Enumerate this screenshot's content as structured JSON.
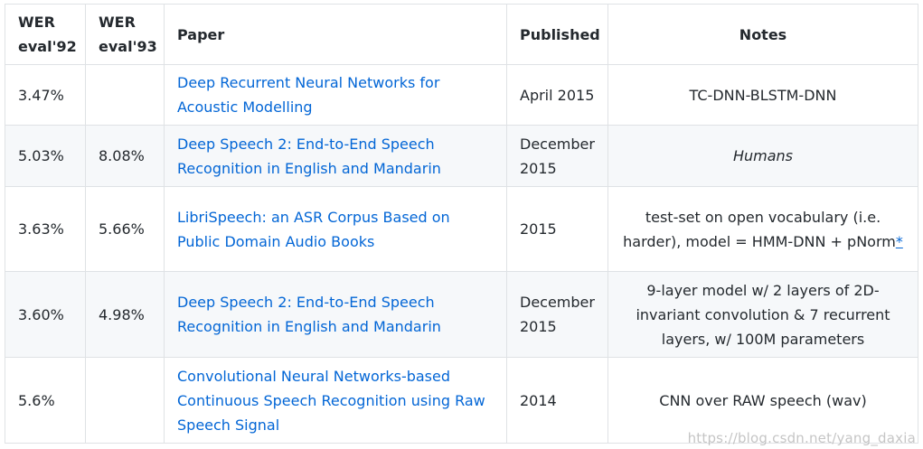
{
  "table": {
    "headers": [
      "WER eval'92",
      "WER eval'93",
      "Paper",
      "Published",
      "Notes"
    ],
    "rows": [
      {
        "wer92": "3.47%",
        "wer93": "",
        "paper": "Deep Recurrent Neural Networks for Acoustic Modelling",
        "published": "April 2015",
        "notes": "TC-DNN-BLSTM-DNN",
        "asterisk": ""
      },
      {
        "wer92": "5.03%",
        "wer93": "8.08%",
        "paper": "Deep Speech 2: End-to-End Speech Recognition in English and Mandarin",
        "published": "December 2015",
        "notes": "Humans",
        "asterisk": ""
      },
      {
        "wer92": "3.63%",
        "wer93": "5.66%",
        "paper": "LibriSpeech: an ASR Corpus Based on Public Domain Audio Books",
        "published": "2015",
        "notes": "test-set on open vocabulary (i.e. harder), model = HMM-DNN + pNorm",
        "asterisk": "*"
      },
      {
        "wer92": "3.60%",
        "wer93": "4.98%",
        "paper": "Deep Speech 2: End-to-End Speech Recognition in English and Mandarin",
        "published": "December 2015",
        "notes": "9-layer model w/ 2 layers of 2D-invariant convolution & 7 recurrent layers, w/ 100M parameters",
        "asterisk": ""
      },
      {
        "wer92": "5.6%",
        "wer93": "",
        "paper": "Convolutional Neural Networks-based Continuous Speech Recognition using Raw Speech Signal",
        "published": "2014",
        "notes": "CNN over RAW speech (wav)",
        "asterisk": ""
      }
    ]
  },
  "watermark": "https://blog.csdn.net/yang_daxia",
  "colors": {
    "link": "#0366d6",
    "border": "#dfe2e5",
    "stripe": "#f6f8fa",
    "text": "#24292e"
  }
}
